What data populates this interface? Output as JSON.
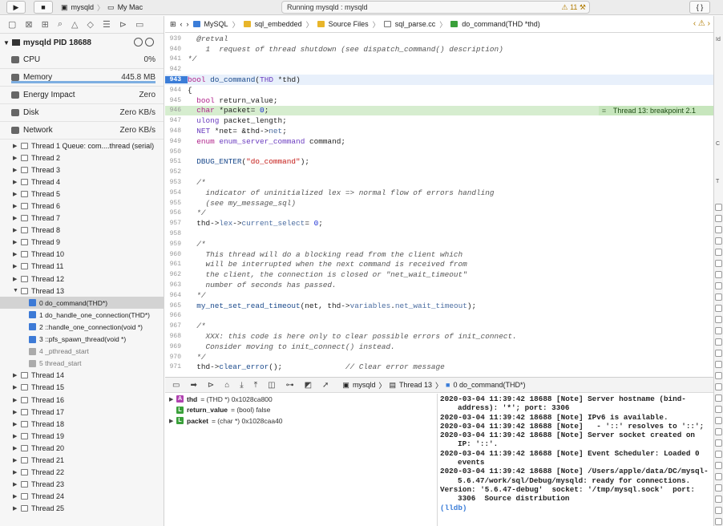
{
  "toolbar": {
    "scheme": "mysqld",
    "destination": "My Mac",
    "status": "Running mysqld : mysqld",
    "warnings": "11",
    "right_button": "{ }"
  },
  "process": {
    "name": "mysqld PID 18688",
    "gauges": [
      {
        "label": "CPU",
        "value": "0%"
      },
      {
        "label": "Memory",
        "value": "445.8 MB"
      },
      {
        "label": "Energy Impact",
        "value": "Zero"
      },
      {
        "label": "Disk",
        "value": "Zero KB/s"
      },
      {
        "label": "Network",
        "value": "Zero KB/s"
      }
    ]
  },
  "threads_before": [
    "Thread 1 Queue: com....thread (serial)",
    "Thread 2",
    "Thread 3",
    "Thread 4",
    "Thread 5",
    "Thread 6",
    "Thread 7",
    "Thread 8",
    "Thread 9",
    "Thread 10",
    "Thread 11",
    "Thread 12"
  ],
  "thread_expanded": "Thread 13",
  "frames": [
    {
      "label": "0 do_command(THD*)",
      "sys": false
    },
    {
      "label": "1 do_handle_one_connection(THD*)",
      "sys": false
    },
    {
      "label": "2 ::handle_one_connection(void *)",
      "sys": false
    },
    {
      "label": "3 ::pfs_spawn_thread(void *)",
      "sys": false
    },
    {
      "label": "4 _pthread_start",
      "sys": true
    },
    {
      "label": "5 thread_start",
      "sys": true
    }
  ],
  "threads_after": [
    "Thread 14",
    "Thread 15",
    "Thread 16",
    "Thread 17",
    "Thread 18",
    "Thread 19",
    "Thread 20",
    "Thread 21",
    "Thread 22",
    "Thread 23",
    "Thread 24",
    "Thread 25"
  ],
  "jumpbar": [
    "MySQL",
    "sql_embedded",
    "Source Files",
    "sql_parse.cc",
    "do_command(THD *thd)"
  ],
  "editor": {
    "breakpoint_label": "Thread 13: breakpoint 2.1",
    "lines": [
      {
        "n": "939",
        "html": "  <span class=\"cm\">@retval</span>"
      },
      {
        "n": "940",
        "html": "<span class=\"cm\">    1  request of thread shutdown (see dispatch_command() description)</span>"
      },
      {
        "n": "941",
        "html": "<span class=\"cm\">*/</span>"
      },
      {
        "n": "942",
        "html": ""
      },
      {
        "n": "943",
        "html": "<span class=\"kw\">bool</span> <span class=\"fn\">do_command</span>(<span class=\"ty\">THD</span> *thd)"
      },
      {
        "n": "944",
        "html": "{"
      },
      {
        "n": "945",
        "html": "  <span class=\"kw\">bool</span> return_value;"
      },
      {
        "n": "946",
        "html": "  <span class=\"kw\">char</span> *packet= <span class=\"nu\">0</span>;"
      },
      {
        "n": "947",
        "html": "  <span class=\"ty\">ulong</span> packet_length;"
      },
      {
        "n": "948",
        "html": "  <span class=\"ty\">NET</span> *net= &amp;thd-&gt;<span class=\"mm\">net</span>;"
      },
      {
        "n": "949",
        "html": "  <span class=\"kw\">enum</span> <span class=\"ty\">enum_server_command</span> command;"
      },
      {
        "n": "950",
        "html": ""
      },
      {
        "n": "951",
        "html": "  <span class=\"fn\">DBUG_ENTER</span>(<span class=\"st\">\"do_command\"</span>);"
      },
      {
        "n": "952",
        "html": ""
      },
      {
        "n": "953",
        "html": "<span class=\"cm\">  /*</span>"
      },
      {
        "n": "954",
        "html": "<span class=\"cm\">    indicator of uninitialized lex =&gt; normal flow of errors handling</span>"
      },
      {
        "n": "955",
        "html": "<span class=\"cm\">    (see my_message_sql)</span>"
      },
      {
        "n": "956",
        "html": "<span class=\"cm\">  */</span>"
      },
      {
        "n": "957",
        "html": "  thd-&gt;<span class=\"mm\">lex</span>-&gt;<span class=\"mm\">current_select</span>= <span class=\"nu\">0</span>;"
      },
      {
        "n": "958",
        "html": ""
      },
      {
        "n": "959",
        "html": "<span class=\"cm\">  /*</span>"
      },
      {
        "n": "960",
        "html": "<span class=\"cm\">    This thread will do a blocking read from the client which</span>"
      },
      {
        "n": "961",
        "html": "<span class=\"cm\">    will be interrupted when the next command is received from</span>"
      },
      {
        "n": "962",
        "html": "<span class=\"cm\">    the client, the connection is closed or \"net_wait_timeout\"</span>"
      },
      {
        "n": "963",
        "html": "<span class=\"cm\">    number of seconds has passed.</span>"
      },
      {
        "n": "964",
        "html": "<span class=\"cm\">  */</span>"
      },
      {
        "n": "965",
        "html": "  <span class=\"fn\">my_net_set_read_timeout</span>(net, thd-&gt;<span class=\"mm\">variables</span>.<span class=\"mm\">net_wait_timeout</span>);"
      },
      {
        "n": "966",
        "html": ""
      },
      {
        "n": "967",
        "html": "<span class=\"cm\">  /*</span>"
      },
      {
        "n": "968",
        "html": "<span class=\"cm\">    XXX: this code is here only to clear possible errors of init_connect.</span>"
      },
      {
        "n": "969",
        "html": "<span class=\"cm\">    Consider moving to init_connect() instead.</span>"
      },
      {
        "n": "970",
        "html": "<span class=\"cm\">  */</span>"
      },
      {
        "n": "971",
        "html": "  thd-&gt;<span class=\"fn\">clear_error</span>();              <span class=\"cm\">// Clear error message</span>"
      }
    ]
  },
  "debugbar": {
    "crumbs": [
      "mysqld",
      "Thread 13",
      "0 do_command(THD*)"
    ]
  },
  "variables": [
    {
      "badge": "A",
      "color": "#b042b0",
      "name": "thd",
      "value": "= (THD *) 0x1028ca800",
      "expandable": true
    },
    {
      "badge": "L",
      "color": "#3aa03a",
      "name": "return_value",
      "value": "= (bool) false",
      "expandable": false
    },
    {
      "badge": "L",
      "color": "#3aa03a",
      "name": "packet",
      "value": "= (char *) 0x1028caa40",
      "expandable": true
    }
  ],
  "console": [
    "2020-03-04 11:39:42 18688 [Note] Server hostname (bind-address): '*'; port: 3306",
    "2020-03-04 11:39:42 18688 [Note] IPv6 is available.",
    "2020-03-04 11:39:42 18688 [Note]   - '::' resolves to '::';",
    "2020-03-04 11:39:42 18688 [Note] Server socket created on IP: '::'.",
    "2020-03-04 11:39:42 18688 [Note] Event Scheduler: Loaded 0 events",
    "2020-03-04 11:39:42 18688 [Note] /Users/apple/data/DC/mysql-5.6.47/work/sql/Debug/mysqld: ready for connections.",
    "Version: '5.6.47-debug'  socket: '/tmp/mysql.sock'  port: 3306  Source distribution"
  ],
  "console_prompt": "(lldb)",
  "inspector": {
    "label_top": "Id",
    "label_mid": "C",
    "label_low": "T"
  },
  "colors": {
    "accent": "#3b7dd8",
    "breakpoint": "#c7e6bd",
    "current_line": "#e8f0fb"
  }
}
